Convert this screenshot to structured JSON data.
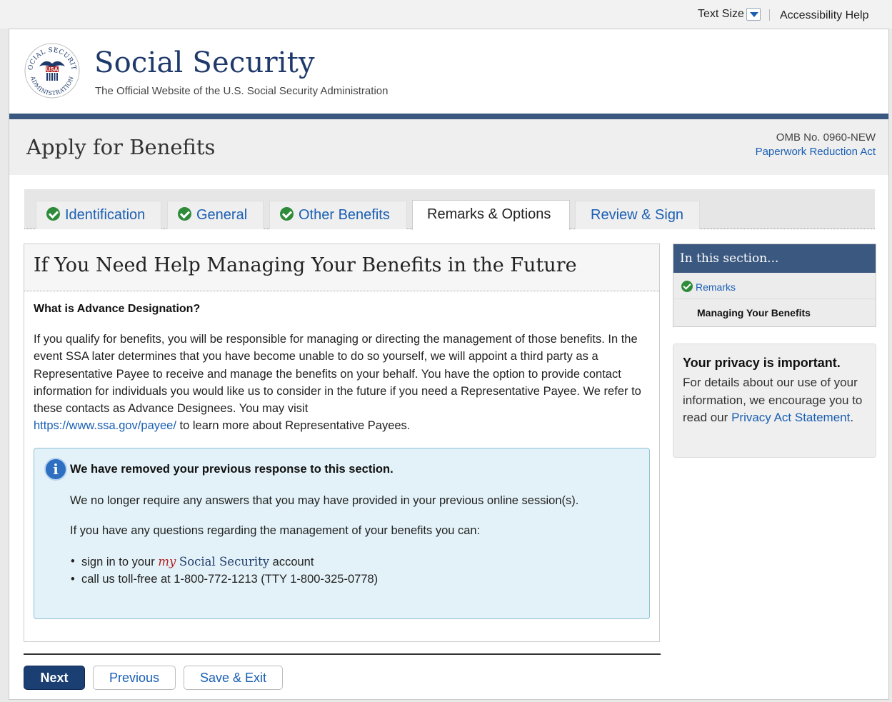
{
  "util": {
    "text_size": "Text Size",
    "accessibility_help": "Accessibility Help"
  },
  "header": {
    "seal_text_top": "SOCIAL SECURITY",
    "seal_text_bottom": "ADMINISTRATION",
    "seal_usa": "USA",
    "brand": "Social Security",
    "tagline": "The Official Website of the U.S. Social Security Administration"
  },
  "titleband": {
    "title": "Apply for Benefits",
    "omb": "OMB No. 0960-NEW",
    "paperwork_link": "Paperwork Reduction Act"
  },
  "tabs": [
    {
      "label": "Identification",
      "completed": true,
      "active": false
    },
    {
      "label": "General",
      "completed": true,
      "active": false
    },
    {
      "label": "Other Benefits",
      "completed": true,
      "active": false
    },
    {
      "label": "Remarks & Options",
      "completed": false,
      "active": true
    },
    {
      "label": "Review & Sign",
      "completed": false,
      "active": false
    }
  ],
  "main": {
    "heading": "If You Need Help Managing Your Benefits in the Future",
    "question": "What is Advance Designation?",
    "paragraph": "If you qualify for benefits, you will be responsible for managing or directing the management of those benefits. In the event SSA later determines that you have become unable to do so yourself, we will appoint a third party as a Representative Payee to receive and manage the benefits on your behalf. You have the option to provide contact information for individuals you would like us to consider in the future if you need a Representative Payee. We refer to these contacts as Advance Designees. You may visit",
    "payee_link": "https://www.ssa.gov/payee/",
    "paragraph_end": "to learn more about Representative Payees."
  },
  "notice": {
    "title": "We have removed your previous response to this section.",
    "p1": "We no longer require any answers that you may have provided in your previous online session(s).",
    "p2": "If you have any questions regarding the management of your benefits you can:",
    "item1_pre": "sign in to your",
    "item1_my": "my",
    "item1_ss": "Social Security",
    "item1_post": "account",
    "item2": "call us toll-free at 1-800-772-1213 (TTY 1-800-325-0778)"
  },
  "buttons": {
    "next": "Next",
    "previous": "Previous",
    "save_exit": "Save & Exit"
  },
  "sidebar": {
    "heading": "In this section...",
    "items": [
      {
        "label": "Remarks",
        "completed": true
      },
      {
        "label": "Managing Your Benefits",
        "completed": false
      }
    ]
  },
  "privacy": {
    "title": "Your privacy is important.",
    "text": "For details about our use of your information, we encourage you to read our",
    "link": "Privacy Act Statement",
    "end": "."
  },
  "colors": {
    "brand_navy": "#1f3a6a",
    "band_blue": "#3b5880",
    "link_blue": "#1a5fb4",
    "check_green": "#2e8b3a",
    "notice_bg": "#e3f2f8"
  }
}
